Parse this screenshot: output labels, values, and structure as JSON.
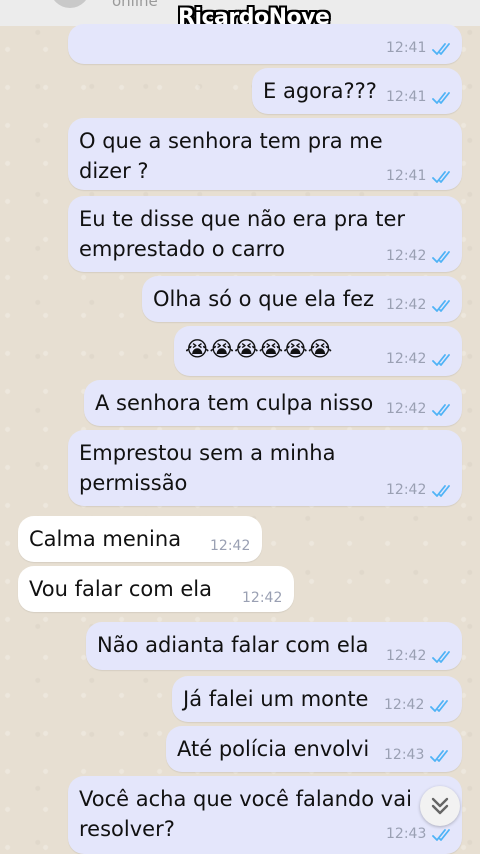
{
  "header": {
    "status": "online",
    "watermark": "RicardoNove"
  },
  "messages": [
    {
      "dir": "out",
      "text": "",
      "time": "12:41"
    },
    {
      "dir": "out",
      "text": "E agora???",
      "time": "12:41"
    },
    {
      "dir": "out",
      "text": "O que a senhora tem pra me\ndizer ?",
      "time": "12:41"
    },
    {
      "dir": "out",
      "text": "Eu te disse que não era pra ter\nemprestado o carro",
      "time": "12:42"
    },
    {
      "dir": "out",
      "text": "Olha só o que ela fez",
      "time": "12:42"
    },
    {
      "dir": "out",
      "text": "😭😭😭😭😭😭",
      "time": "12:42"
    },
    {
      "dir": "out",
      "text": "A senhora tem culpa nisso",
      "time": "12:42"
    },
    {
      "dir": "out",
      "text": "Emprestou sem a minha\npermissão",
      "time": "12:42"
    },
    {
      "dir": "in",
      "text": "Calma menina",
      "time": "12:42"
    },
    {
      "dir": "in",
      "text": "Vou falar com ela",
      "time": "12:42"
    },
    {
      "dir": "out",
      "text": "Não adianta falar com ela",
      "time": "12:42"
    },
    {
      "dir": "out",
      "text": "Já falei um monte",
      "time": "12:42"
    },
    {
      "dir": "out",
      "text": "Até polícia envolvi",
      "time": "12:43"
    },
    {
      "dir": "out",
      "text": "Você acha que você falando vai\nresolver?",
      "time": "12:43"
    }
  ],
  "colors": {
    "tick": "#4fb3f6",
    "outgoing": "#e4e6fb",
    "incoming": "#ffffff"
  },
  "icons": {
    "read_receipt": "double-check-icon",
    "scroll": "chevron-double-down-icon"
  }
}
